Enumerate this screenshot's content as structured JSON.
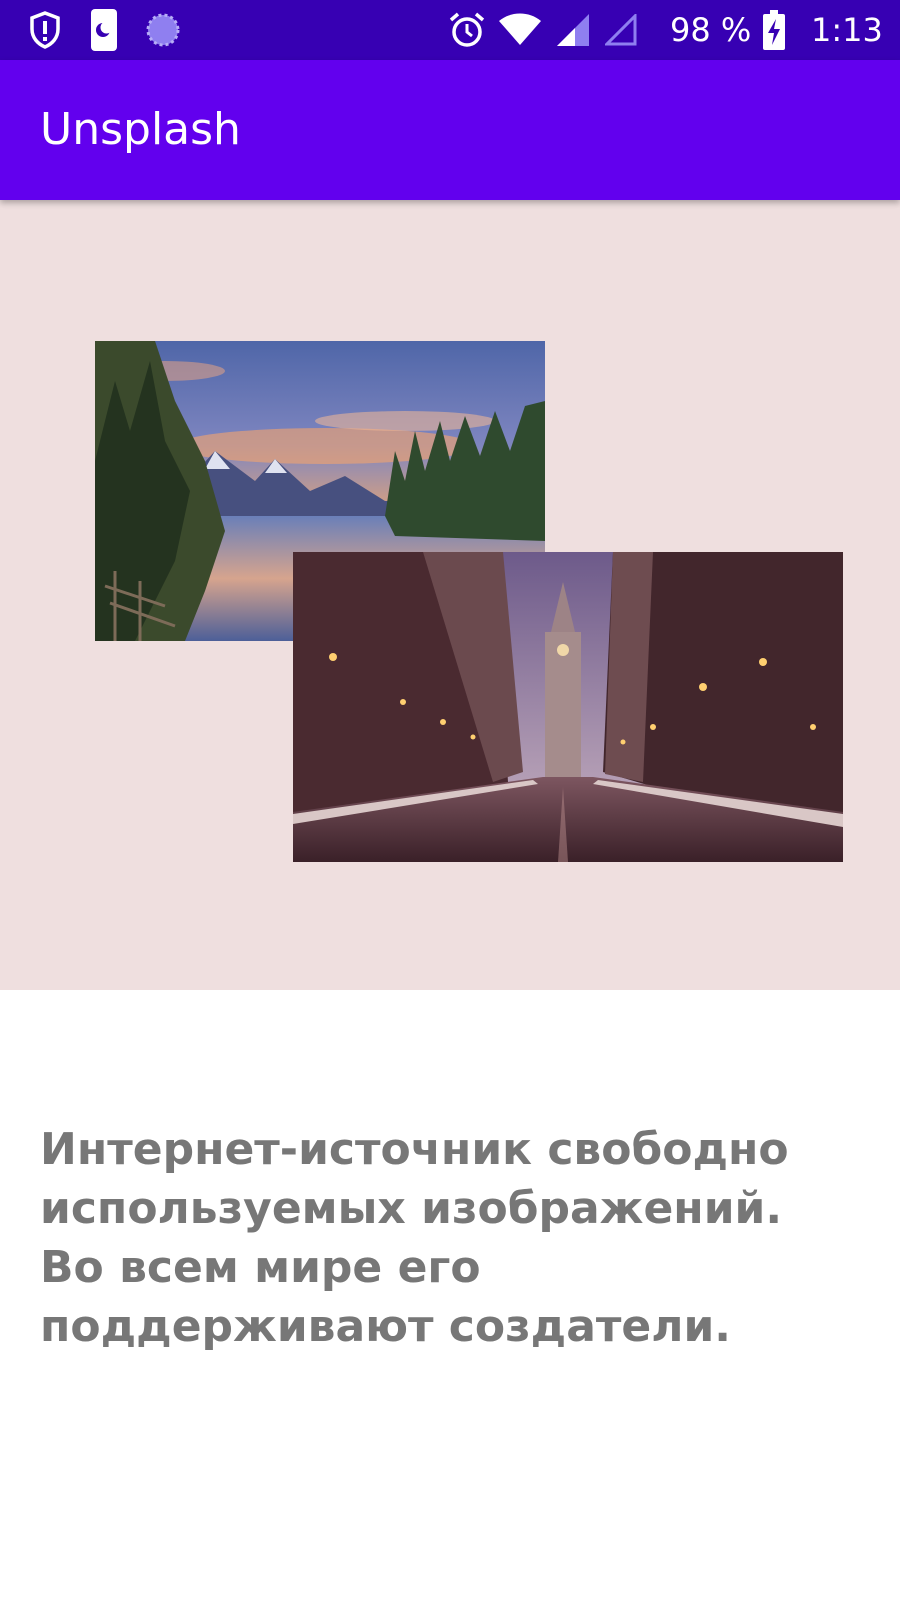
{
  "status_bar": {
    "icons": [
      "shield-alert-icon",
      "do-not-disturb-icon",
      "loading-spinner-icon",
      "alarm-icon",
      "wifi-icon",
      "cellular-signal-icon",
      "cellular-signal-empty-icon",
      "battery-charging-icon"
    ],
    "battery": "98 %",
    "time": "1:13"
  },
  "app_bar": {
    "title": "Unsplash"
  },
  "hero": {
    "images": [
      {
        "subject": "mountain lake at sunset with pine forest",
        "icon": "landscape-photo"
      },
      {
        "subject": "city street at dusk with clock tower",
        "icon": "city-photo"
      }
    ]
  },
  "description": {
    "text": "Интернет-источник свободно используемых изображений.\nВо всем мире его поддерживают создатели."
  },
  "colors": {
    "status_bar": "#3700b3",
    "app_bar": "#6200ee",
    "hero_background": "#efdfdf",
    "description_text": "#777777"
  }
}
